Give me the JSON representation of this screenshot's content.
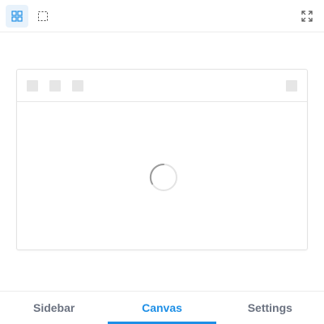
{
  "toolbar": {
    "buttons": [
      {
        "icon": "grid-view-icon",
        "active": true
      },
      {
        "icon": "select-area-icon",
        "active": false
      },
      {
        "icon": "fullscreen-icon",
        "active": false
      }
    ]
  },
  "canvas": {
    "status": "loading"
  },
  "tabs": [
    {
      "label": "Sidebar",
      "active": false
    },
    {
      "label": "Canvas",
      "active": true
    },
    {
      "label": "Settings",
      "active": false
    }
  ],
  "colors": {
    "accent": "#1e8fe6",
    "active_button_bg": "#e8f2fb",
    "tab_text": "#6b7280",
    "placeholder": "#e6e6e6"
  }
}
